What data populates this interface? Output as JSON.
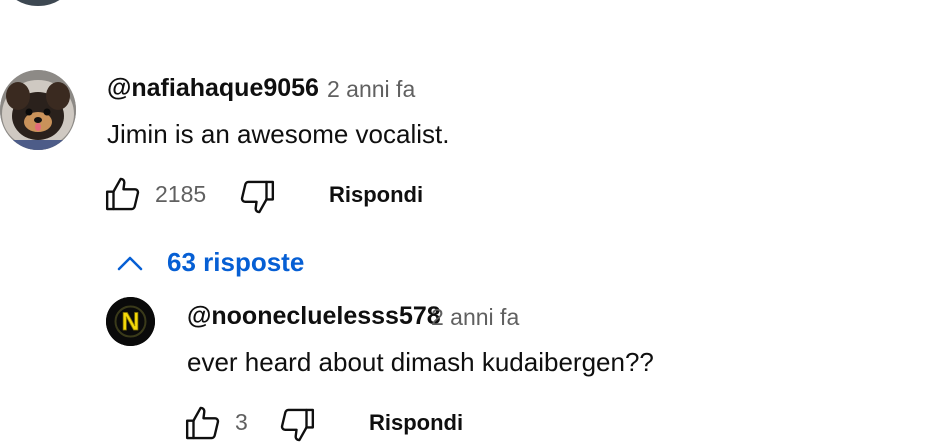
{
  "comment": {
    "author": "@nafiahaque9056",
    "time": "2 anni fa",
    "text": "Jimin is an awesome vocalist.",
    "likes": "2185",
    "reply_label": "Rispondi"
  },
  "replies_toggle": {
    "label": "63 risposte",
    "icon": "chevron-up-icon",
    "color": "#065fd4"
  },
  "reply": {
    "author": "@noonecluelesss578",
    "time": "2 anni fa",
    "text": "ever heard about dimash kudaibergen??",
    "likes": "3",
    "reply_label": "Rispondi",
    "avatar_letter": "N"
  },
  "colors": {
    "text": "#0f0f0f",
    "secondary": "#606060",
    "accent": "#065fd4",
    "avatar_badge": "#f5d90a"
  }
}
